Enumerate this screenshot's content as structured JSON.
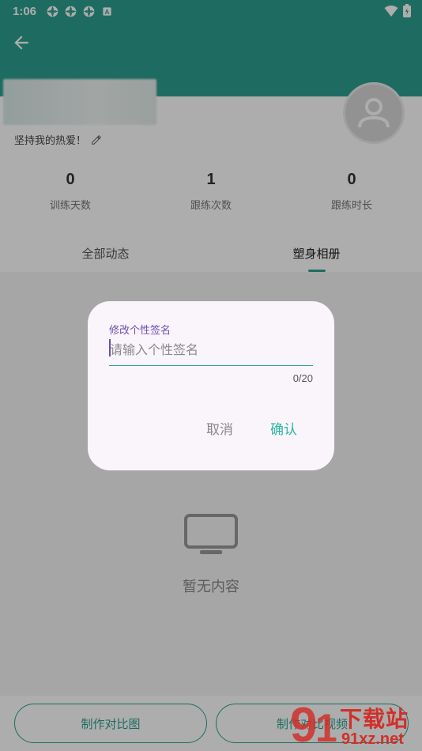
{
  "status_bar": {
    "time": "1:06",
    "icons": [
      "app-icon",
      "app-icon",
      "app-icon",
      "a-notification-icon"
    ],
    "right_icons": [
      "wifi-icon",
      "battery-icon"
    ]
  },
  "profile": {
    "signature": "坚持我的热爱！",
    "stats": [
      {
        "value": "0",
        "label": "训练天数"
      },
      {
        "value": "1",
        "label": "跟练次数"
      },
      {
        "value": "0",
        "label": "跟练时长"
      }
    ]
  },
  "tabs": [
    {
      "label": "全部动态",
      "active": false
    },
    {
      "label": "塑身相册",
      "active": true
    }
  ],
  "empty_state": {
    "text": "暂无内容"
  },
  "bottom_buttons": {
    "left": "制作对比图",
    "right": "制作对比视频"
  },
  "dialog": {
    "label": "修改个性签名",
    "placeholder": "请输入个性签名",
    "value": "",
    "counter": "0/20",
    "cancel": "取消",
    "confirm": "确认"
  },
  "watermark": {
    "text": "下载站",
    "url": "91xz.net"
  },
  "colors": {
    "primary": "#2d9f8f",
    "accent": "#2ab7a0",
    "dialog_bg": "#faf4fb",
    "label": "#6a4fb0"
  }
}
